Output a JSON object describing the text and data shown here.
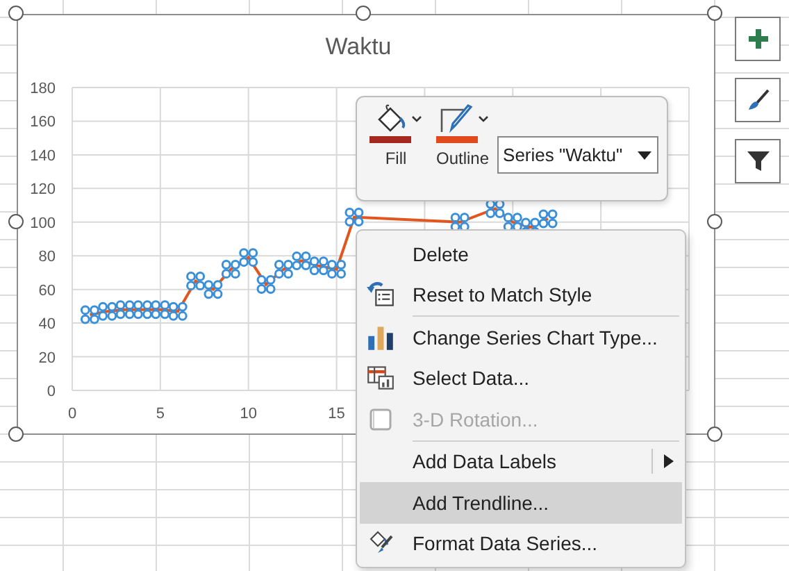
{
  "chart": {
    "chart_data": {
      "type": "line",
      "title": "Waktu",
      "grid": true,
      "x": [
        1,
        2,
        3,
        4,
        5,
        6,
        7,
        8,
        9,
        10,
        11,
        12,
        13,
        14,
        15,
        16,
        22,
        24,
        25,
        26,
        27
      ],
      "series": [
        {
          "color": "#e0561e",
          "values": [
            45,
            47,
            48,
            48,
            48,
            47,
            65,
            60,
            72,
            79,
            63,
            72,
            77,
            74,
            72,
            103,
            100,
            108,
            100,
            97,
            102
          ]
        }
      ],
      "xlim": [
        0,
        35
      ],
      "ylim": [
        0,
        180
      ],
      "xticks": [
        0,
        5,
        10,
        15
      ],
      "yticks": [
        0,
        20,
        40,
        60,
        80,
        100,
        120,
        140,
        160,
        180
      ]
    }
  },
  "mini_toolbar": {
    "fill": {
      "label": "Fill",
      "color": "#a5281f"
    },
    "outline": {
      "label": "Outline",
      "color": "#e04a1c"
    },
    "series_select": {
      "value": "Series \"Waktu\""
    }
  },
  "context_menu": [
    {
      "kind": "item",
      "label": "Delete",
      "disabled": false,
      "selected": false,
      "submenu": false
    },
    {
      "kind": "item",
      "label": "Reset to Match Style",
      "disabled": false,
      "selected": false,
      "submenu": false
    },
    {
      "kind": "separator"
    },
    {
      "kind": "item",
      "label": "Change Series Chart Type...",
      "disabled": false,
      "selected": false,
      "submenu": false
    },
    {
      "kind": "item",
      "label": "Select Data...",
      "disabled": false,
      "selected": false,
      "submenu": false
    },
    {
      "kind": "item",
      "label": "3-D Rotation...",
      "disabled": true,
      "selected": false,
      "submenu": false
    },
    {
      "kind": "separator"
    },
    {
      "kind": "item",
      "label": "Add Data Labels",
      "disabled": false,
      "selected": false,
      "submenu": true
    },
    {
      "kind": "item",
      "label": "Add Trendline...",
      "disabled": false,
      "selected": true,
      "submenu": false
    },
    {
      "kind": "item",
      "label": "Format Data Series...",
      "disabled": false,
      "selected": false,
      "submenu": false
    }
  ]
}
